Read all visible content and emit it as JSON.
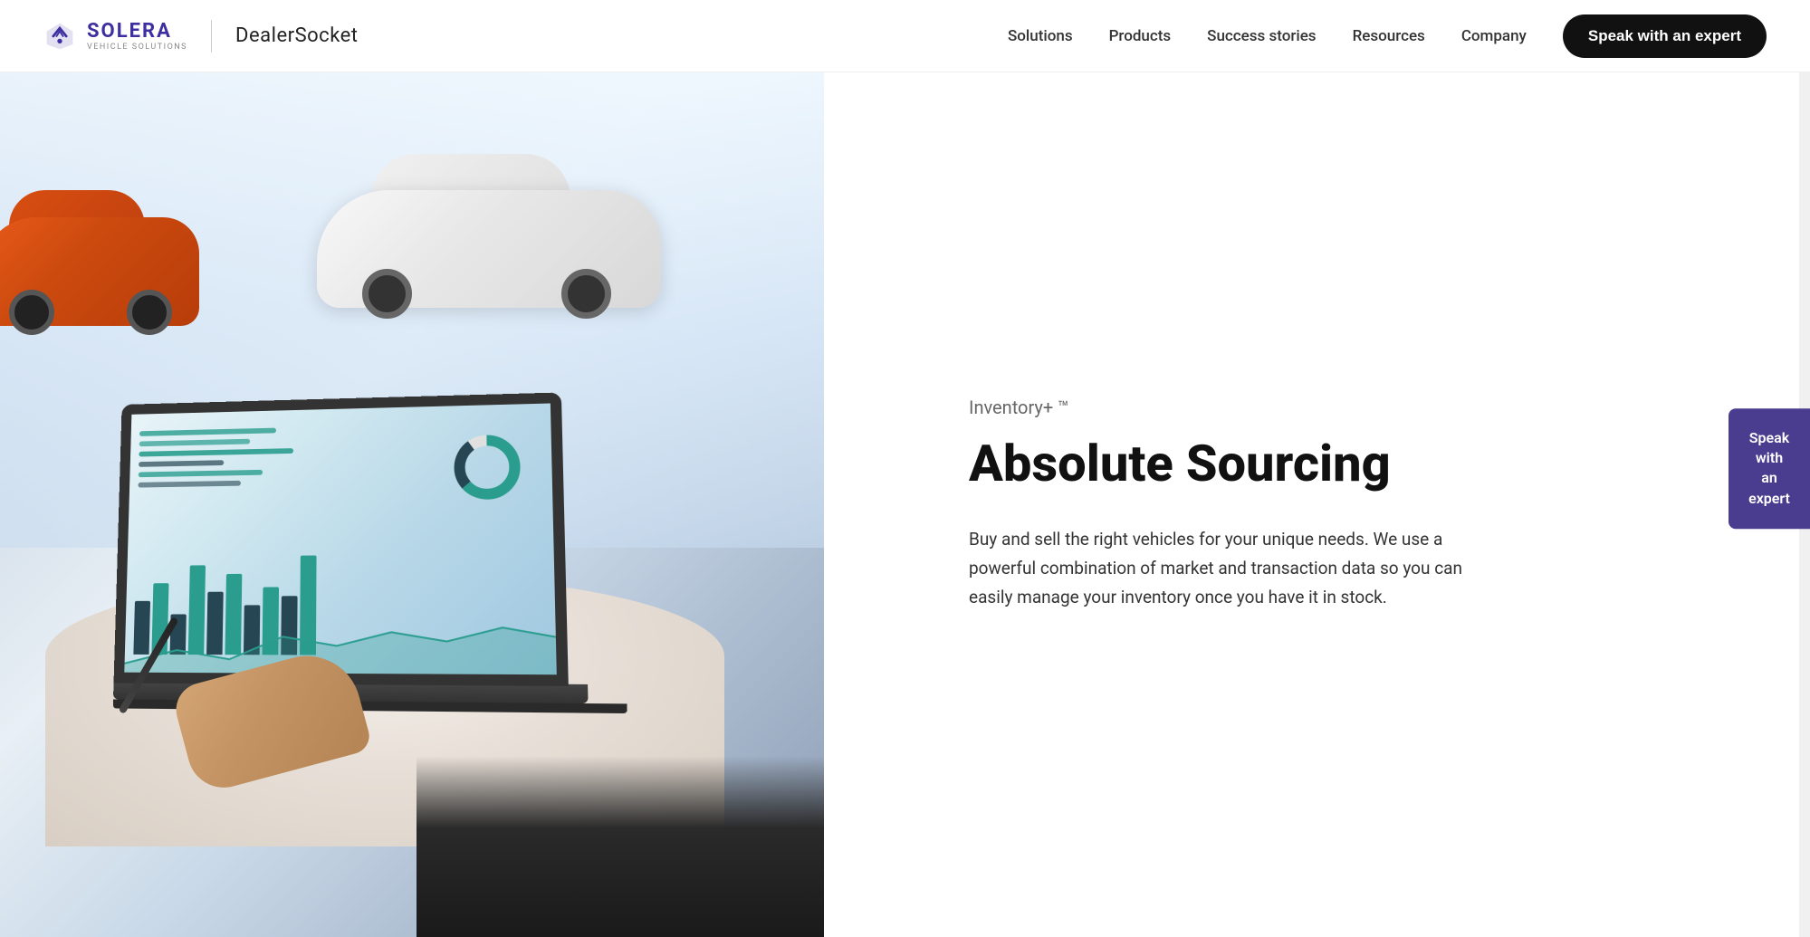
{
  "brand": {
    "solera_text": "SOLERA",
    "solera_sub": "Vehicle Solutions",
    "dealer_socket": "DealerSocket"
  },
  "navbar": {
    "links": [
      {
        "id": "solutions",
        "label": "Solutions"
      },
      {
        "id": "products",
        "label": "Products"
      },
      {
        "id": "success-stories",
        "label": "Success stories"
      },
      {
        "id": "resources",
        "label": "Resources"
      },
      {
        "id": "company",
        "label": "Company"
      }
    ],
    "cta_label": "Speak with an expert"
  },
  "hero": {
    "product_label": "Inventory+ ™",
    "product_title": "Absolute Sourcing",
    "product_description": "Buy and sell the right vehicles for your unique needs. We use a powerful combination of market and transaction data so you can easily manage your inventory once you have it in stock."
  },
  "sidebar_cta": {
    "line1": "Speak with",
    "line2": "an expert"
  },
  "colors": {
    "purple_dark": "#3d2fa0",
    "purple_float": "#4a3d8f",
    "nav_cta_bg": "#111111",
    "text_dark": "#111111",
    "text_medium": "#333333",
    "text_light": "#666666"
  }
}
